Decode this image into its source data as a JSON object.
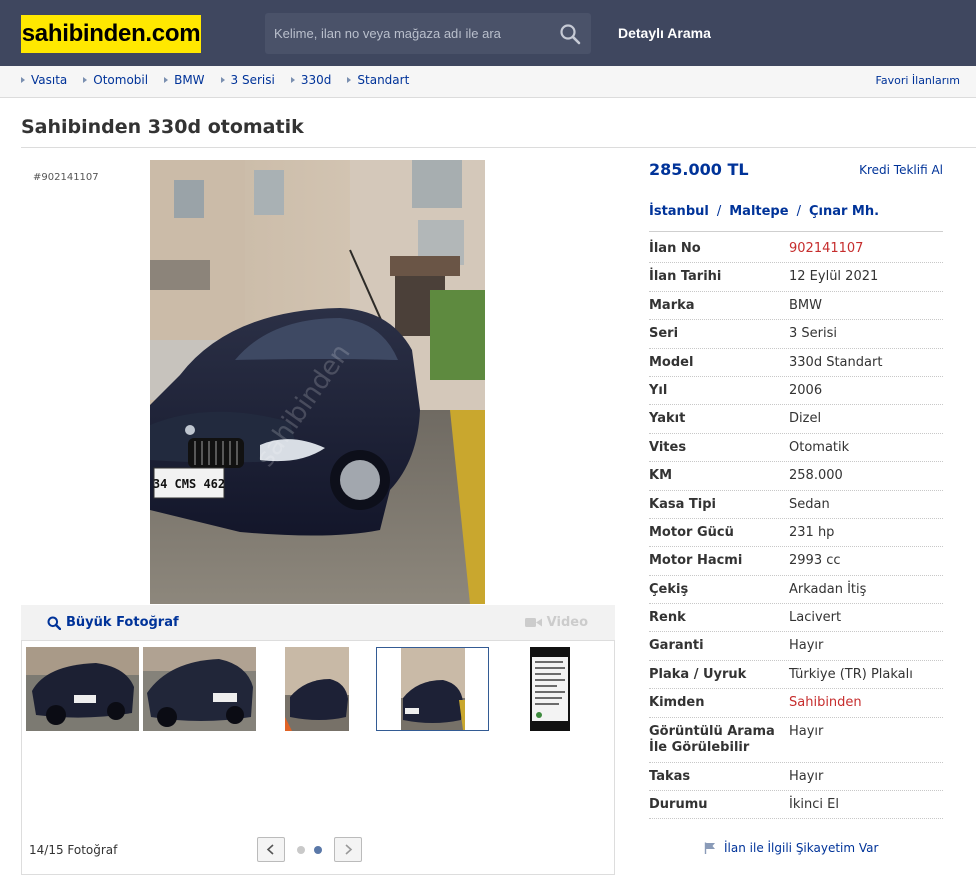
{
  "header": {
    "logo": "sahibinden.com",
    "search_placeholder": "Kelime, ilan no veya mağaza adı ile ara",
    "detailed_search": "Detaylı Arama"
  },
  "breadcrumb": {
    "items": [
      "Vasıta",
      "Otomobil",
      "BMW",
      "3 Serisi",
      "330d",
      "Standart"
    ],
    "favorites": "Favori İlanlarım"
  },
  "listing": {
    "title": "Sahibinden 330d otomatik",
    "ad_number_label": "#902141107",
    "price": "285.000 TL",
    "credit_link": "Kredi Teklifi Al",
    "location": [
      "İstanbul",
      "Maltepe",
      "Çınar Mh."
    ],
    "location_separator": "/",
    "details": [
      {
        "key": "İlan No",
        "value": "902141107",
        "highlight": true
      },
      {
        "key": "İlan Tarihi",
        "value": "12 Eylül 2021"
      },
      {
        "key": "Marka",
        "value": "BMW"
      },
      {
        "key": "Seri",
        "value": "3 Serisi"
      },
      {
        "key": "Model",
        "value": "330d Standart"
      },
      {
        "key": "Yıl",
        "value": "2006"
      },
      {
        "key": "Yakıt",
        "value": "Dizel"
      },
      {
        "key": "Vites",
        "value": "Otomatik"
      },
      {
        "key": "KM",
        "value": "258.000"
      },
      {
        "key": "Kasa Tipi",
        "value": "Sedan"
      },
      {
        "key": "Motor Gücü",
        "value": "231 hp"
      },
      {
        "key": "Motor Hacmi",
        "value": "2993 cc"
      },
      {
        "key": "Çekiş",
        "value": "Arkadan İtiş"
      },
      {
        "key": "Renk",
        "value": "Lacivert"
      },
      {
        "key": "Garanti",
        "value": "Hayır"
      },
      {
        "key": "Plaka / Uyruk",
        "value": "Türkiye (TR) Plakalı"
      },
      {
        "key": "Kimden",
        "value": "Sahibinden",
        "highlight": true
      },
      {
        "key": "Görüntülü Arama İle Görülebilir",
        "value": "Hayır"
      },
      {
        "key": "Takas",
        "value": "Hayır"
      },
      {
        "key": "Durumu",
        "value": "İkinci El"
      }
    ],
    "complaint_link": "İlan ile İlgili Şikayetim Var"
  },
  "gallery": {
    "big_photo": "Büyük Fotoğraf",
    "video": "Video",
    "photo_count": "14/15 Fotoğraf",
    "plate_text": "34 CMS 462",
    "watermark": "sahibinden",
    "selected_thumb": 4,
    "page_dots": 2,
    "active_dot": 2
  },
  "colors": {
    "header_bg": "#3f475f",
    "logo_bg": "#ffe800",
    "link": "#003399",
    "highlight_red": "#c62d2d"
  }
}
